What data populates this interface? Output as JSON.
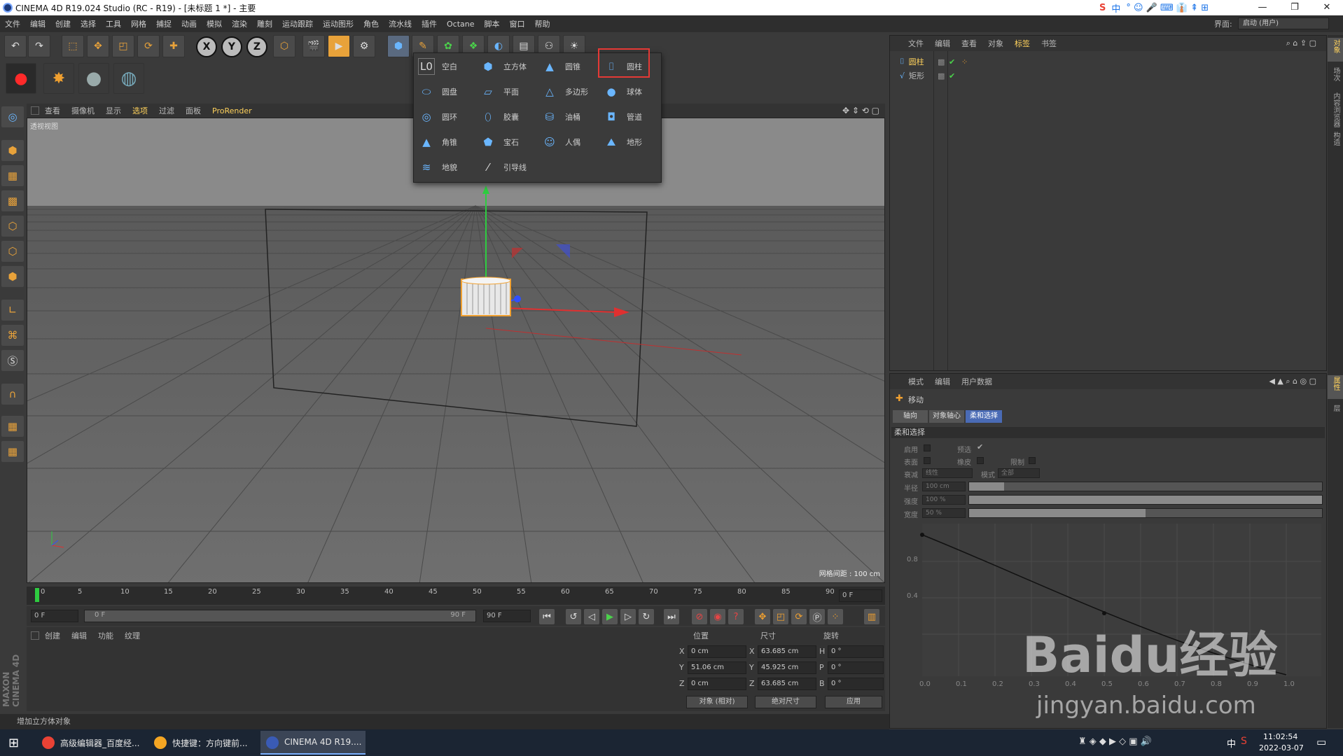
{
  "window": {
    "title": "CINEMA 4D R19.024 Studio (RC - R19) - [未标题 1 *] - 主要",
    "minimize": "—",
    "restore": "❐",
    "close": "✕"
  },
  "menu": [
    "文件",
    "编辑",
    "创建",
    "选择",
    "工具",
    "网格",
    "捕捉",
    "动画",
    "模拟",
    "渲染",
    "雕刻",
    "运动跟踪",
    "运动图形",
    "角色",
    "流水线",
    "插件",
    "Octane",
    "脚本",
    "窗口",
    "帮助"
  ],
  "layout_label": "界面:",
  "layout_value": "启动 (用户)",
  "toolbar": {
    "x": "X",
    "y": "Y",
    "z": "Z"
  },
  "viewport": {
    "menus": [
      "查看",
      "摄像机",
      "显示",
      "选项",
      "过滤",
      "面板",
      "ProRender"
    ],
    "label": "透视视图",
    "grid_info": "网格间距 : 100 cm"
  },
  "popup": {
    "items": [
      {
        "label": "空白",
        "icon": "null-icon"
      },
      {
        "label": "立方体",
        "icon": "cube-icon"
      },
      {
        "label": "圆锥",
        "icon": "cone-icon"
      },
      {
        "label": "圆柱",
        "icon": "cylinder-icon"
      },
      {
        "label": "圆盘",
        "icon": "disc-icon"
      },
      {
        "label": "平面",
        "icon": "plane-icon"
      },
      {
        "label": "多边形",
        "icon": "polygon-icon"
      },
      {
        "label": "球体",
        "icon": "sphere-icon"
      },
      {
        "label": "圆环",
        "icon": "torus-icon"
      },
      {
        "label": "胶囊",
        "icon": "capsule-icon"
      },
      {
        "label": "油桶",
        "icon": "oil-tank-icon"
      },
      {
        "label": "管道",
        "icon": "tube-icon"
      },
      {
        "label": "角锥",
        "icon": "pyramid-icon"
      },
      {
        "label": "宝石",
        "icon": "gem-icon"
      },
      {
        "label": "人偶",
        "icon": "figure-icon"
      },
      {
        "label": "地形",
        "icon": "landscape-icon"
      },
      {
        "label": "地貌",
        "icon": "relief-icon"
      },
      {
        "label": "引导线",
        "icon": "guide-icon"
      }
    ],
    "highlighted": "圆柱"
  },
  "timeline": {
    "ticks": [
      "0",
      "5",
      "10",
      "15",
      "20",
      "25",
      "30",
      "35",
      "40",
      "45",
      "50",
      "55",
      "60",
      "65",
      "70",
      "75",
      "80",
      "85",
      "90"
    ],
    "current_frame": "0 F",
    "start_field": "0 F",
    "range_start": "0 F",
    "range_end": "90 F",
    "end_field": "90 F"
  },
  "material": {
    "menus": [
      "创建",
      "编辑",
      "功能",
      "纹理"
    ]
  },
  "coords": {
    "headers": [
      "位置",
      "尺寸",
      "旋转"
    ],
    "rows": [
      {
        "axis": "X",
        "pos": "0 cm",
        "size_axis": "X",
        "size": "63.685 cm",
        "rot_axis": "H",
        "rot": "0 °"
      },
      {
        "axis": "Y",
        "pos": "51.06 cm",
        "size_axis": "Y",
        "size": "45.925 cm",
        "rot_axis": "P",
        "rot": "0 °"
      },
      {
        "axis": "Z",
        "pos": "0 cm",
        "size_axis": "Z",
        "size": "63.685 cm",
        "rot_axis": "B",
        "rot": "0 °"
      }
    ],
    "mode": "对象 (相对)",
    "size_mode": "绝对尺寸",
    "apply": "应用"
  },
  "status": "增加立方体对象",
  "objects_panel": {
    "menus": [
      "文件",
      "编辑",
      "查看",
      "对象",
      "标签",
      "书签"
    ],
    "active_menu": "标签",
    "objects": [
      {
        "name": "圆柱",
        "color": "#ffd25c"
      },
      {
        "name": "矩形",
        "color": "#bbbbbb"
      }
    ]
  },
  "attributes_panel": {
    "menus": [
      "模式",
      "编辑",
      "用户数据"
    ],
    "title": "移动",
    "tabs": [
      "轴向",
      "对象轴心",
      "柔和选择"
    ],
    "active_tab": "柔和选择",
    "section": "柔和选择",
    "labels": {
      "enable": "启用",
      "preview": "预选",
      "surface": "表面",
      "rubber": "橡皮",
      "restrict": "限制",
      "falloff": "衰减",
      "falloff_value": "线性",
      "mode": "模式",
      "mode_value": "全部",
      "radius": "半径",
      "radius_value": "100 cm",
      "strength": "强度",
      "strength_value": "100 %",
      "width": "宽度",
      "width_value": "50 %"
    },
    "sliders": {
      "radius": 0.1,
      "strength": 1.0,
      "width": 0.5
    },
    "graph_x": [
      "0.0",
      "0.1",
      "0.2",
      "0.3",
      "0.4",
      "0.5",
      "0.6",
      "0.7",
      "0.8",
      "0.9",
      "1.0"
    ],
    "graph_y": [
      "0.8",
      "0.4"
    ]
  },
  "right_tabs": [
    "对象",
    "场次",
    "内容浏览器",
    "构造",
    "属性",
    "层"
  ],
  "brand": "MAXON CINEMA 4D",
  "taskbar": {
    "apps": [
      {
        "label": "高级编辑器_百度经...",
        "color": "#e94235"
      },
      {
        "label": "快捷键：方向键前...",
        "color": "#f5a623"
      },
      {
        "label": "CINEMA 4D R19....",
        "color": "#3a5bb5"
      }
    ],
    "ime": "中",
    "time": "11:02:54",
    "date": "2022-03-07"
  },
  "watermark": {
    "main": "Baidu经验",
    "sub": "jingyan.baidu.com"
  }
}
